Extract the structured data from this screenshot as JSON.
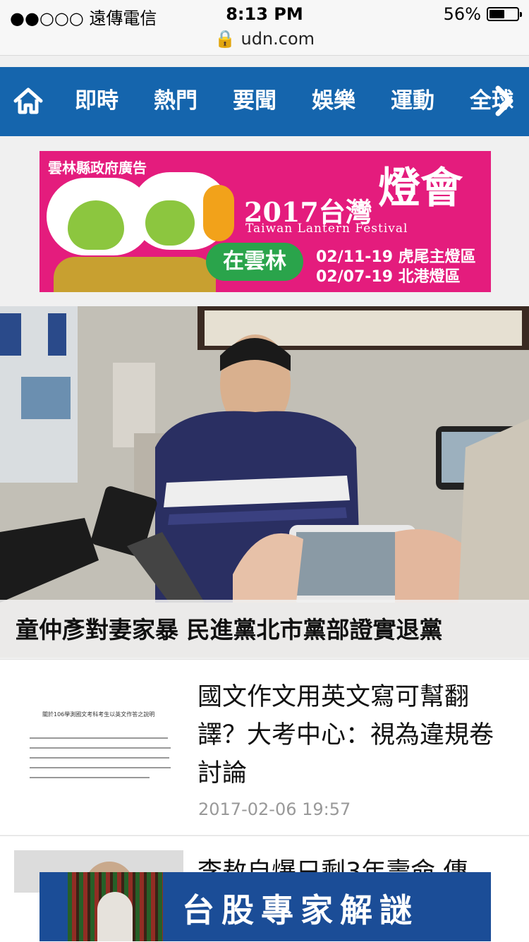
{
  "status_bar": {
    "carrier": "●●○○○ 遠傳電信",
    "time": "8:13 PM",
    "battery": "56%",
    "battery_level": 0.56
  },
  "browser": {
    "url": "udn.com"
  },
  "nav": {
    "items": [
      "即時",
      "熱門",
      "要聞",
      "娛樂",
      "運動",
      "全球"
    ]
  },
  "ad_top": {
    "sponsor": "雲林縣政府廣告",
    "year_title": "2017台灣",
    "title_big": "燈會",
    "subtitle": "Taiwan Lantern Festival",
    "place": "在雲林",
    "date1": "02/11-19 虎尾主燈區",
    "date2": "02/07-19 北港燈區"
  },
  "lead_story": {
    "headline": "童仲彥對妻家暴 民進黨北市黨部證實退黨"
  },
  "story": {
    "title": "國文作文用英文寫可幫翻譯？大考中心：視為違規卷討論",
    "date": "2017-02-06 19:57",
    "thumb_text": "關於106學測國文考科考生以英文作答之說明"
  },
  "story2": {
    "title": "李敖自爆只剩3年壽命 傳"
  },
  "ad_bottom": {
    "text": "台股專家解謎"
  },
  "colors": {
    "nav_bg": "#1565ad",
    "ad_pink": "#e41c7d",
    "ad_blue": "#1b4d97"
  }
}
